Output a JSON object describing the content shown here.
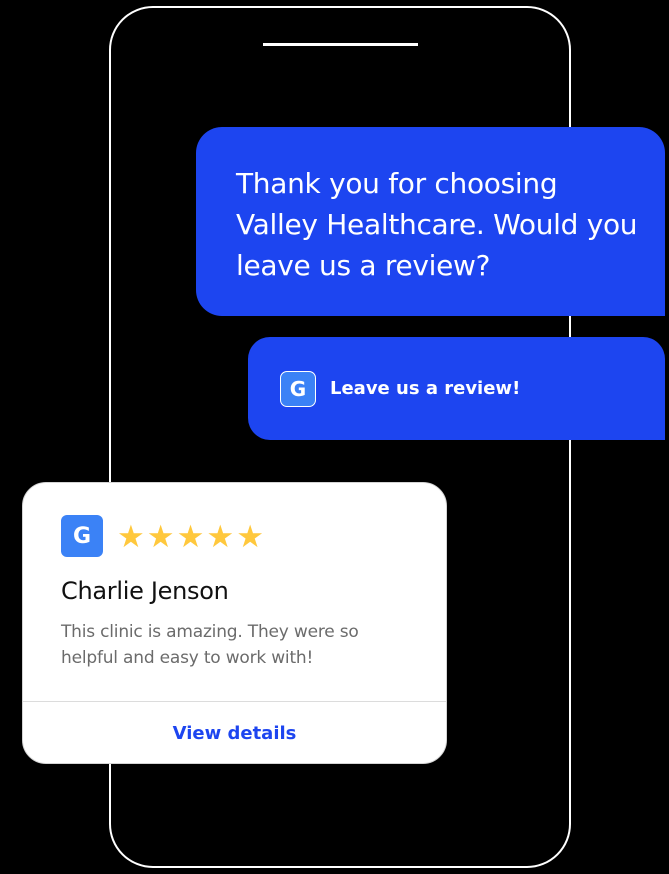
{
  "message": {
    "text": "Thank you for choosing Valley Healthcare. Would you leave us a review?"
  },
  "cta": {
    "icon_letter": "G",
    "label": "Leave us a review!"
  },
  "review": {
    "icon_letter": "G",
    "rating": 5,
    "rating_max": 5,
    "star_glyph": "★",
    "name": "Charlie Jenson",
    "text": "This clinic is amazing. They were so helpful and easy to work with!",
    "action_label": "View details"
  },
  "colors": {
    "background": "#000000",
    "bubble": "#1d45f0",
    "google_icon": "#3b82f6",
    "star": "#ffc83d",
    "link": "#1d45f0"
  }
}
